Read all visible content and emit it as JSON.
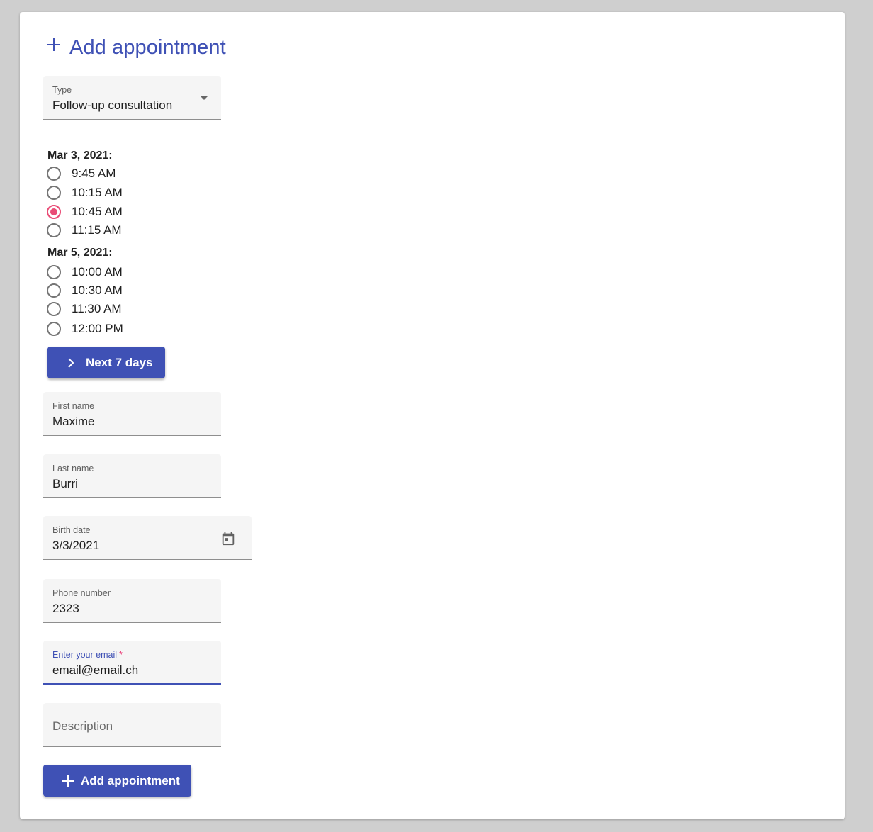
{
  "header": {
    "title": "Add appointment",
    "icon": "plus-icon",
    "accent_color": "#3f51b5"
  },
  "type_select": {
    "label": "Type",
    "value": "Follow-up consultation",
    "icon": "dropdown-arrow-icon"
  },
  "slots": {
    "groups": [
      {
        "date": "Mar 3, 2021:",
        "times": [
          "9:45 AM",
          "10:15 AM",
          "10:45 AM",
          "11:15 AM"
        ],
        "selected": "10:45 AM"
      },
      {
        "date": "Mar 5, 2021:",
        "times": [
          "10:00 AM",
          "10:30 AM",
          "11:30 AM",
          "12:00 PM"
        ],
        "selected": null
      }
    ],
    "selected_color": "#e94c76",
    "next_button_label": "Next 7 days",
    "next_button_icon": "chevron-right-icon"
  },
  "form": {
    "first_name": {
      "label": "First name",
      "value": "Maxime"
    },
    "last_name": {
      "label": "Last name",
      "value": "Burri"
    },
    "birth_date": {
      "label": "Birth date",
      "value": "3/3/2021",
      "icon": "calendar-icon"
    },
    "phone": {
      "label": "Phone number",
      "value": "2323"
    },
    "email": {
      "label": "Enter your email",
      "required_mark": "*",
      "value": "email@email.ch"
    },
    "description": {
      "placeholder": "Description",
      "value": ""
    }
  },
  "submit": {
    "label": "Add appointment",
    "icon": "plus-icon"
  }
}
